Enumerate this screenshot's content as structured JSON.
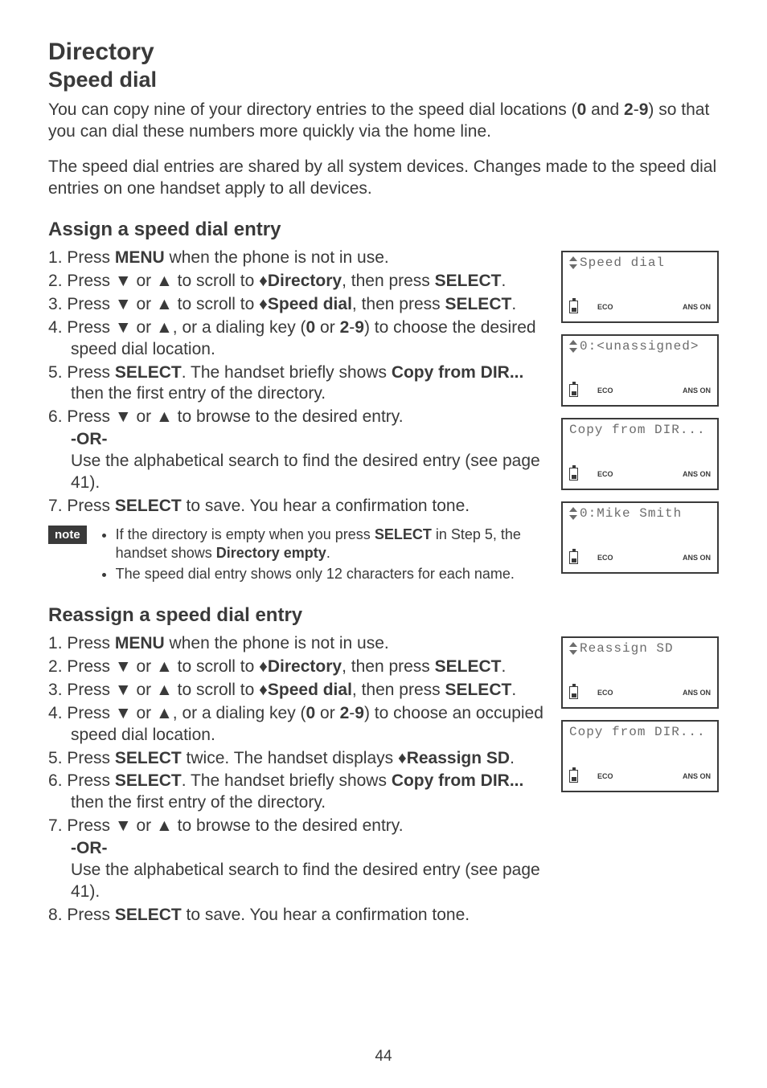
{
  "title": "Directory",
  "subtitle": "Speed dial",
  "intro1_a": "You can copy nine of your directory entries to the speed dial locations (",
  "intro1_b": "0",
  "intro1_c": " and ",
  "intro1_d": "2",
  "intro1_e": "-",
  "intro1_f": "9",
  "intro1_g": ") so that you can dial these numbers more quickly via the home line.",
  "intro2": "The speed dial entries are shared by all system devices. Changes made to the speed dial entries on one handset apply to all devices.",
  "assign": {
    "heading": "Assign a speed dial entry",
    "step1_a": "Press ",
    "step1_b": "MENU",
    "step1_c": " when the phone is not in use.",
    "step2_a": "Press ▼ or ▲ to scroll to ",
    "step2_b": "Directory",
    "step2_c": ", then press ",
    "step2_d": "SELECT",
    "step2_e": ".",
    "step3_a": "Press ▼ or ▲ to scroll to ",
    "step3_b": "Speed dial",
    "step3_c": ", then press ",
    "step3_d": "SELECT",
    "step3_e": ".",
    "step4_a": "Press ▼ or ▲, or a dialing key (",
    "step4_b": "0",
    "step4_c": " or ",
    "step4_d": "2",
    "step4_e": "-",
    "step4_f": "9",
    "step4_g": ") to choose the desired speed dial location.",
    "step5_a": "Press ",
    "step5_b": "SELECT",
    "step5_c": ". The handset briefly shows ",
    "step5_d": "Copy from DIR...",
    "step5_e": " then the first entry of the directory.",
    "step6": "Press ▼ or ▲ to browse to the desired entry.",
    "or": "-OR-",
    "step6b": "Use the alphabetical search to find the desired entry (see page 41).",
    "step7_a": "Press ",
    "step7_b": "SELECT",
    "step7_c": " to save. You hear a confirmation tone."
  },
  "note": {
    "badge": "note",
    "item1_a": "If the directory is empty when you press ",
    "item1_b": "SELECT",
    "item1_c": " in Step 5, the handset shows ",
    "item1_d": "Directory empty",
    "item1_e": ".",
    "item2": "The speed dial entry shows only 12 characters for each name."
  },
  "reassign": {
    "heading": "Reassign a speed dial entry",
    "step1_a": "Press ",
    "step1_b": "MENU",
    "step1_c": " when the phone is not in use.",
    "step2_a": "Press ▼ or ▲ to scroll to ",
    "step2_b": "Directory",
    "step2_c": ", then press ",
    "step2_d": "SELECT",
    "step2_e": ".",
    "step3_a": "Press ▼ or ▲ to scroll to ",
    "step3_b": "Speed dial",
    "step3_c": ", then press ",
    "step3_d": "SELECT",
    "step3_e": ".",
    "step4_a": "Press ▼ or ▲, or a dialing key (",
    "step4_b": "0",
    "step4_c": " or ",
    "step4_d": "2",
    "step4_e": "-",
    "step4_f": "9",
    "step4_g": ") to choose an occupied speed dial location.",
    "step5_a": "Press ",
    "step5_b": "SELECT",
    "step5_c": " twice. The handset displays ",
    "step5_d": "Reassign SD",
    "step5_e": ".",
    "step6_a": "Press ",
    "step6_b": "SELECT",
    "step6_c": ". The handset briefly shows ",
    "step6_d": "Copy from DIR...",
    "step6_e": " then the first entry of the directory.",
    "step7": "Press ▼ or ▲ to browse to the desired entry.",
    "or": "-OR-",
    "step7b": "Use the alphabetical search to find the desired entry (see page 41).",
    "step8_a": "Press ",
    "step8_b": "SELECT",
    "step8_c": " to save. You hear a confirmation tone."
  },
  "lcd": {
    "eco": "ECO",
    "ans": "ANS ON",
    "screen1": "Speed dial",
    "screen2": "0:<unassigned>",
    "screen3": "Copy from DIR...",
    "screen4": "0:Mike Smith",
    "screen5": "Reassign SD",
    "screen6": "Copy from DIR..."
  },
  "page_number": "44"
}
